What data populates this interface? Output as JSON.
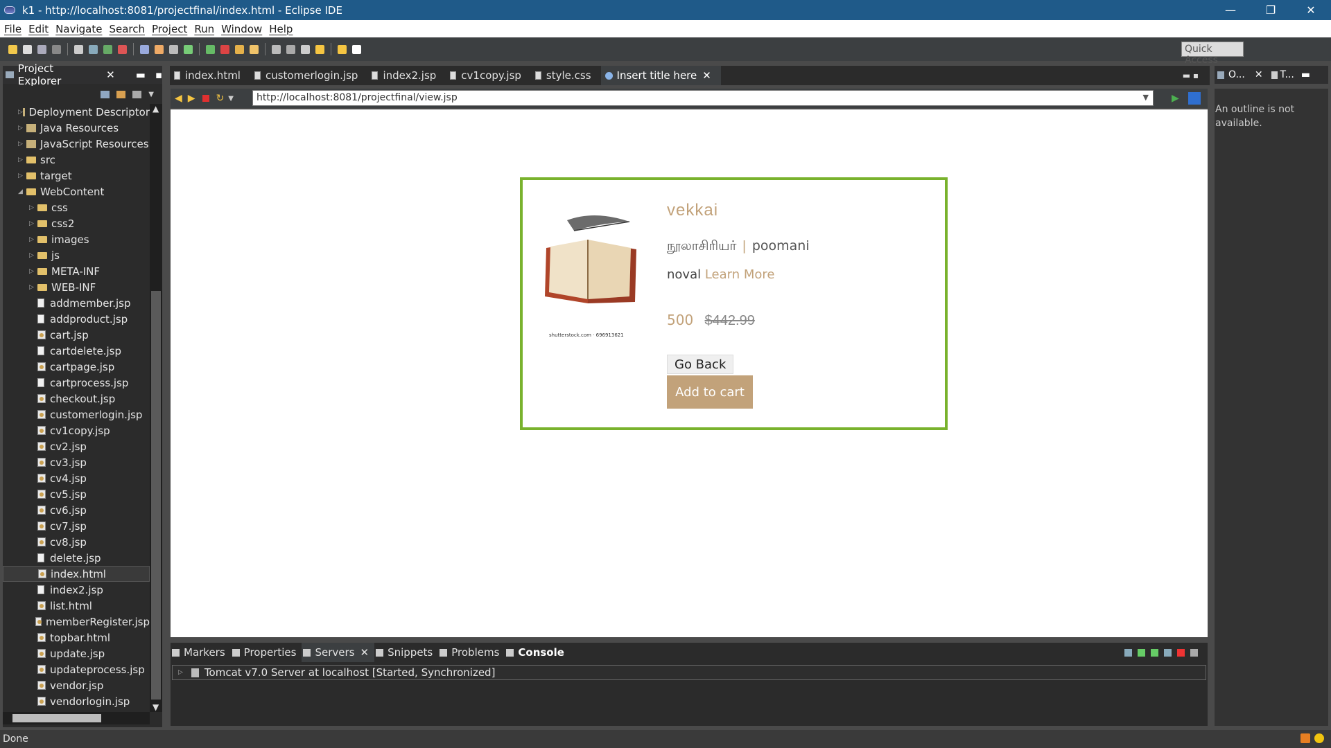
{
  "window": {
    "title": "k1 - http://localhost:8081/projectfinal/index.html - Eclipse IDE",
    "minimize": "—",
    "maximize": "❐",
    "close": "✕"
  },
  "menu": [
    "File",
    "Edit",
    "Navigate",
    "Search",
    "Project",
    "Run",
    "Window",
    "Help"
  ],
  "toolbar": {
    "quick_access": "Quick Access"
  },
  "project_explorer": {
    "title": "Project Explorer",
    "items": [
      {
        "label": "Deployment Descriptor",
        "indent": 1,
        "type": "pkg",
        "arrow": "▷"
      },
      {
        "label": "Java Resources",
        "indent": 1,
        "type": "pkg",
        "arrow": "▷"
      },
      {
        "label": "JavaScript Resources",
        "indent": 1,
        "type": "pkg",
        "arrow": "▷"
      },
      {
        "label": "src",
        "indent": 1,
        "type": "folder",
        "arrow": "▷"
      },
      {
        "label": "target",
        "indent": 1,
        "type": "folder",
        "arrow": "▷"
      },
      {
        "label": "WebContent",
        "indent": 1,
        "type": "folder",
        "arrow": "◢"
      },
      {
        "label": "css",
        "indent": 2,
        "type": "folder",
        "arrow": "▷"
      },
      {
        "label": "css2",
        "indent": 2,
        "type": "folder",
        "arrow": "▷"
      },
      {
        "label": "images",
        "indent": 2,
        "type": "folder",
        "arrow": "▷"
      },
      {
        "label": "js",
        "indent": 2,
        "type": "folder",
        "arrow": "▷"
      },
      {
        "label": "META-INF",
        "indent": 2,
        "type": "folder",
        "arrow": "▷"
      },
      {
        "label": "WEB-INF",
        "indent": 2,
        "type": "folder",
        "arrow": "▷"
      },
      {
        "label": "addmember.jsp",
        "indent": 2,
        "type": "file",
        "arrow": ""
      },
      {
        "label": "addproduct.jsp",
        "indent": 2,
        "type": "file",
        "arrow": ""
      },
      {
        "label": "cart.jsp",
        "indent": 2,
        "type": "jsp",
        "arrow": ""
      },
      {
        "label": "cartdelete.jsp",
        "indent": 2,
        "type": "file",
        "arrow": ""
      },
      {
        "label": "cartpage.jsp",
        "indent": 2,
        "type": "jsp",
        "arrow": ""
      },
      {
        "label": "cartprocess.jsp",
        "indent": 2,
        "type": "file",
        "arrow": ""
      },
      {
        "label": "checkout.jsp",
        "indent": 2,
        "type": "jsp",
        "arrow": ""
      },
      {
        "label": "customerlogin.jsp",
        "indent": 2,
        "type": "jsp",
        "arrow": ""
      },
      {
        "label": "cv1copy.jsp",
        "indent": 2,
        "type": "jsp",
        "arrow": ""
      },
      {
        "label": "cv2.jsp",
        "indent": 2,
        "type": "jsp",
        "arrow": ""
      },
      {
        "label": "cv3.jsp",
        "indent": 2,
        "type": "jsp",
        "arrow": ""
      },
      {
        "label": "cv4.jsp",
        "indent": 2,
        "type": "jsp",
        "arrow": ""
      },
      {
        "label": "cv5.jsp",
        "indent": 2,
        "type": "jsp",
        "arrow": ""
      },
      {
        "label": "cv6.jsp",
        "indent": 2,
        "type": "jsp",
        "arrow": ""
      },
      {
        "label": "cv7.jsp",
        "indent": 2,
        "type": "jsp",
        "arrow": ""
      },
      {
        "label": "cv8.jsp",
        "indent": 2,
        "type": "jsp",
        "arrow": ""
      },
      {
        "label": "delete.jsp",
        "indent": 2,
        "type": "file",
        "arrow": ""
      },
      {
        "label": "index.html",
        "indent": 2,
        "type": "jsp",
        "arrow": "",
        "selected": true
      },
      {
        "label": "index2.jsp",
        "indent": 2,
        "type": "file",
        "arrow": ""
      },
      {
        "label": "list.html",
        "indent": 2,
        "type": "jsp",
        "arrow": ""
      },
      {
        "label": "memberRegister.jsp",
        "indent": 2,
        "type": "jsp",
        "arrow": ""
      },
      {
        "label": "topbar.html",
        "indent": 2,
        "type": "jsp",
        "arrow": ""
      },
      {
        "label": "update.jsp",
        "indent": 2,
        "type": "jsp",
        "arrow": ""
      },
      {
        "label": "updateprocess.jsp",
        "indent": 2,
        "type": "jsp",
        "arrow": ""
      },
      {
        "label": "vendor.jsp",
        "indent": 2,
        "type": "jsp",
        "arrow": ""
      },
      {
        "label": "vendorlogin.jsp",
        "indent": 2,
        "type": "jsp",
        "arrow": ""
      }
    ]
  },
  "editor_tabs": [
    {
      "label": "index.html",
      "active": false
    },
    {
      "label": "customerlogin.jsp",
      "active": false
    },
    {
      "label": "index2.jsp",
      "active": false
    },
    {
      "label": "cv1copy.jsp",
      "active": false
    },
    {
      "label": "style.css",
      "active": false
    },
    {
      "label": "Insert title here",
      "active": true
    }
  ],
  "browser": {
    "url": "http://localhost:8081/projectfinal/view.jsp"
  },
  "product": {
    "title": "vekkai",
    "author_label": "நூலாசிரியர்",
    "separator": "|",
    "author": "poomani",
    "category": "noval",
    "learn_more": "Learn More",
    "price": "500",
    "old_price": "$442.99",
    "image_credit": "shutterstock.com · 696913621",
    "go_back": "Go Back",
    "add_to_cart": "Add to cart"
  },
  "outline": {
    "tab1": "O...",
    "tab2": "T...",
    "message": "An outline is not available."
  },
  "bottom_panel": {
    "tabs": [
      {
        "label": "Markers"
      },
      {
        "label": "Properties"
      },
      {
        "label": "Servers",
        "active": true
      },
      {
        "label": "Snippets"
      },
      {
        "label": "Problems"
      },
      {
        "label": "Console",
        "bold": true
      }
    ],
    "server_row": "Tomcat v7.0 Server at localhost  [Started, Synchronized]"
  },
  "status": {
    "text": "Done"
  },
  "colors": {
    "accent_gold": "#c2a27a",
    "card_border": "#79b22d",
    "titlebar": "#1f5a89"
  }
}
